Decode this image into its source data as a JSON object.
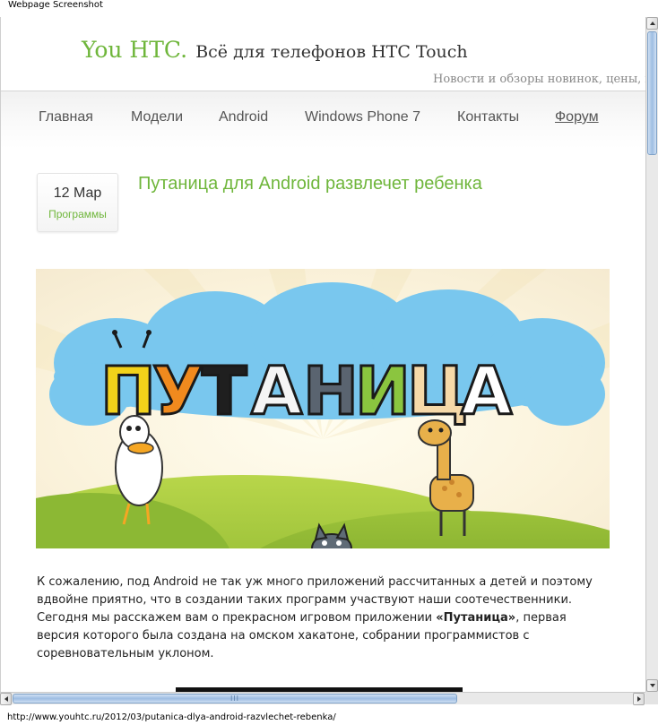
{
  "window": {
    "caption": "Webpage Screenshot"
  },
  "site": {
    "name": "You HTC.",
    "tagline": "Всё для телефонов HTC Touch",
    "description": "Новости и обзоры новинок, цены, прош",
    "accent_color": "#6fb63b"
  },
  "nav": {
    "items": [
      {
        "label": "Главная"
      },
      {
        "label": "Модели"
      },
      {
        "label": "Android"
      },
      {
        "label": "Windows Phone 7"
      },
      {
        "label": "Контакты"
      },
      {
        "label": "Форум"
      }
    ]
  },
  "post": {
    "date": "12 Мар",
    "category": "Программы",
    "title": "Путаница для Android развлечет ребенка",
    "banner": {
      "logo_text": "ПУТАНИЦА"
    },
    "body": {
      "part1": "К сожалению, под Android не так уж много приложений рассчитанных а детей и поэтому вдвойне приятно, что в создании таких программ участвуют наши соотечественники. Сегодня мы расскажем вам о прекрасном игровом приложении ",
      "bold": "«Путаница»",
      "part2": ", первая версия которого была создана на омском хакатоне, собрании программистов с соревновательным уклоном."
    }
  },
  "scrollbars": {
    "horizontal_grip": "III"
  },
  "status_bar": {
    "url": "http://www.youhtc.ru/2012/03/putanica-dlya-android-razvlechet-rebenka/"
  }
}
